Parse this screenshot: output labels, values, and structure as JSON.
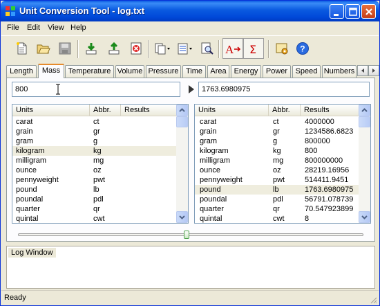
{
  "window": {
    "title": "Unit Conversion Tool - log.txt"
  },
  "menu": [
    "File",
    "Edit",
    "View",
    "Help"
  ],
  "toolbar": {
    "icons": [
      "new-file-icon",
      "open-folder-icon",
      "save-disk-icon",
      "import-icon",
      "export-icon",
      "delete-icon",
      "copy-dropdown-icon",
      "paste-dropdown-icon",
      "find-icon",
      "font-size-icon",
      "sum-icon",
      "settings-icon",
      "help-icon"
    ],
    "sum_label": "Σ",
    "font_label": "A",
    "help_label": "?"
  },
  "tabs": [
    "Length",
    "Mass",
    "Temperature",
    "Volume",
    "Pressure",
    "Time",
    "Area",
    "Energy",
    "Power",
    "Speed",
    "Numbers"
  ],
  "active_tab": "Mass",
  "input": {
    "value": "800"
  },
  "output": {
    "value": "1763.6980975"
  },
  "columns": {
    "units": "Units",
    "abbr": "Abbr.",
    "results": "Results"
  },
  "left_list": {
    "rows": [
      {
        "unit": "carat",
        "abbr": "ct"
      },
      {
        "unit": "grain",
        "abbr": "gr"
      },
      {
        "unit": "gram",
        "abbr": "g"
      },
      {
        "unit": "kilogram",
        "abbr": "kg"
      },
      {
        "unit": "milligram",
        "abbr": "mg"
      },
      {
        "unit": "ounce",
        "abbr": "oz"
      },
      {
        "unit": "pennyweight",
        "abbr": "pwt"
      },
      {
        "unit": "pound",
        "abbr": "lb"
      },
      {
        "unit": "poundal",
        "abbr": "pdl"
      },
      {
        "unit": "quarter",
        "abbr": "qr"
      },
      {
        "unit": "quintal",
        "abbr": "cwt"
      }
    ],
    "selected": "kilogram"
  },
  "right_list": {
    "rows": [
      {
        "unit": "carat",
        "abbr": "ct",
        "result": "4000000"
      },
      {
        "unit": "grain",
        "abbr": "gr",
        "result": "1234586.6823"
      },
      {
        "unit": "gram",
        "abbr": "g",
        "result": "800000"
      },
      {
        "unit": "kilogram",
        "abbr": "kg",
        "result": "800"
      },
      {
        "unit": "milligram",
        "abbr": "mg",
        "result": "800000000"
      },
      {
        "unit": "ounce",
        "abbr": "oz",
        "result": "28219.16956"
      },
      {
        "unit": "pennyweight",
        "abbr": "pwt",
        "result": "514411.9451"
      },
      {
        "unit": "pound",
        "abbr": "lb",
        "result": "1763.6980975"
      },
      {
        "unit": "poundal",
        "abbr": "pdl",
        "result": "56791.078739"
      },
      {
        "unit": "quarter",
        "abbr": "qr",
        "result": "70.547923899"
      },
      {
        "unit": "quintal",
        "abbr": "cwt",
        "result": "8"
      }
    ],
    "selected": "pound"
  },
  "log": {
    "label": "Log Window"
  },
  "status": {
    "text": "Ready"
  },
  "colors": {
    "title_blue": "#0a5ae0",
    "selection": "#efedde",
    "active_tab_accent": "#e68b2c"
  }
}
